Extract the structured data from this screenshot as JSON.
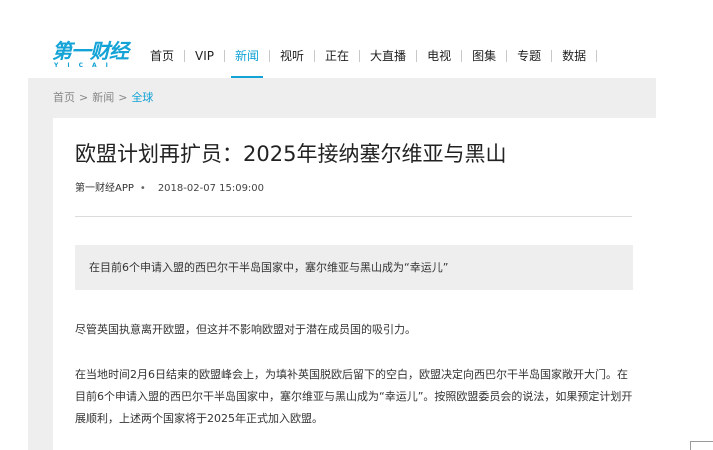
{
  "header": {
    "logo_text": "第一财经",
    "logo_subtext": "YICAI",
    "nav": [
      {
        "label": "首页",
        "active": false
      },
      {
        "label": "VIP",
        "active": false
      },
      {
        "label": "新闻",
        "active": true
      },
      {
        "label": "视听",
        "active": false
      },
      {
        "label": "正在",
        "active": false
      },
      {
        "label": "大直播",
        "active": false
      },
      {
        "label": "电视",
        "active": false
      },
      {
        "label": "图集",
        "active": false
      },
      {
        "label": "专题",
        "active": false
      },
      {
        "label": "数据",
        "active": false
      }
    ],
    "accent_color": "#13a3d6"
  },
  "breadcrumb": {
    "items": [
      "首页",
      "新闻",
      "全球"
    ],
    "separator": ">"
  },
  "article": {
    "title": "欧盟计划再扩员：2025年接纳塞尔维亚与黑山",
    "source": "第一财经APP",
    "dot": "•",
    "datetime": "2018-02-07 15:09:00",
    "summary": "在目前6个申请入盟的西巴尔干半岛国家中，塞尔维亚与黑山成为“幸运儿”",
    "paragraphs": [
      "尽管英国执意离开欧盟，但这并不影响欧盟对于潜在成员国的吸引力。",
      "在当地时间2月6日结束的欧盟峰会上，为填补英国脱欧后留下的空白，欧盟决定向西巴尔干半岛国家敞开大门。在目前6个申请入盟的西巴尔干半岛国家中，塞尔维亚与黑山成为“幸运儿”。按照欧盟委员会的说法，如果预定计划开展顺利，上述两个国家将于2025年正式加入欧盟。"
    ]
  }
}
